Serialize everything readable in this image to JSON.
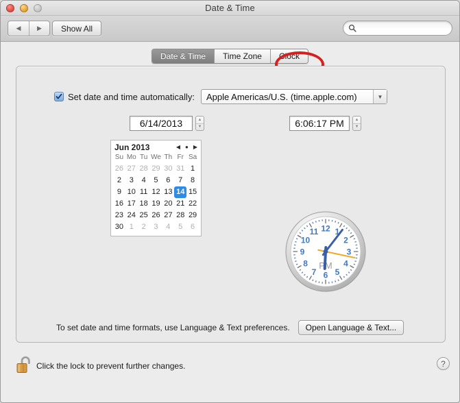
{
  "window": {
    "title": "Date & Time",
    "traffic_lights": [
      "close",
      "minimize",
      "zoom"
    ]
  },
  "toolbar": {
    "back_glyph": "◀",
    "forward_glyph": "▶",
    "show_all_label": "Show All",
    "search_placeholder": "",
    "search_value": "",
    "search_icon": "search-icon"
  },
  "tabs": [
    {
      "label": "Date & Time",
      "selected": true
    },
    {
      "label": "Time Zone",
      "selected": false
    },
    {
      "label": "Clock",
      "selected": false,
      "annotated": true
    }
  ],
  "annotation": {
    "color": "#d81f1f",
    "target": "Clock"
  },
  "panel": {
    "auto": {
      "checked": true,
      "label": "Set date and time automatically:",
      "server_value": "Apple Americas/U.S. (time.apple.com)",
      "dropdown_glyph": "▼"
    },
    "date_field": {
      "value": "6/14/2013",
      "stepper_up": "▲",
      "stepper_down": "▼"
    },
    "time_field": {
      "value": "6:06:17 PM",
      "stepper_up": "▲",
      "stepper_down": "▼"
    },
    "calendar": {
      "title": "Jun 2013",
      "nav": {
        "prev": "◀",
        "today": "●",
        "next": "▶"
      },
      "weekday_headers": [
        "Su",
        "Mo",
        "Tu",
        "We",
        "Th",
        "Fr",
        "Sa"
      ],
      "weeks": [
        [
          {
            "d": "26",
            "muted": true
          },
          {
            "d": "27",
            "muted": true
          },
          {
            "d": "28",
            "muted": true
          },
          {
            "d": "29",
            "muted": true
          },
          {
            "d": "30",
            "muted": true
          },
          {
            "d": "31",
            "muted": true
          },
          {
            "d": "1",
            "muted": false
          }
        ],
        [
          {
            "d": "2"
          },
          {
            "d": "3"
          },
          {
            "d": "4"
          },
          {
            "d": "5"
          },
          {
            "d": "6"
          },
          {
            "d": "7"
          },
          {
            "d": "8"
          }
        ],
        [
          {
            "d": "9"
          },
          {
            "d": "10"
          },
          {
            "d": "11"
          },
          {
            "d": "12"
          },
          {
            "d": "13"
          },
          {
            "d": "14",
            "today": true
          },
          {
            "d": "15"
          }
        ],
        [
          {
            "d": "16"
          },
          {
            "d": "17"
          },
          {
            "d": "18"
          },
          {
            "d": "19"
          },
          {
            "d": "20"
          },
          {
            "d": "21"
          },
          {
            "d": "22"
          }
        ],
        [
          {
            "d": "23"
          },
          {
            "d": "24"
          },
          {
            "d": "25"
          },
          {
            "d": "26"
          },
          {
            "d": "27"
          },
          {
            "d": "28"
          },
          {
            "d": "29"
          }
        ],
        [
          {
            "d": "30"
          },
          {
            "d": "1",
            "muted": true
          },
          {
            "d": "2",
            "muted": true
          },
          {
            "d": "3",
            "muted": true
          },
          {
            "d": "4",
            "muted": true
          },
          {
            "d": "5",
            "muted": true
          },
          {
            "d": "6",
            "muted": true
          }
        ]
      ],
      "selected_day": "14"
    },
    "analog_clock": {
      "meridiem": "PM",
      "hour": 6,
      "minute": 6,
      "second": 17,
      "numerals": [
        "12",
        "1",
        "2",
        "3",
        "4",
        "5",
        "6",
        "7",
        "8",
        "9",
        "10",
        "11"
      ],
      "numeral_color": "#3f78c4",
      "hand_color": "#3b5fa6",
      "second_hand_color": "#f5a623"
    },
    "formats_note": "To set date and time formats, use Language & Text preferences.",
    "open_language_label": "Open Language & Text..."
  },
  "footer": {
    "lock_state": "unlocked",
    "lock_text": "Click the lock to prevent further changes.",
    "help_label": "?"
  }
}
